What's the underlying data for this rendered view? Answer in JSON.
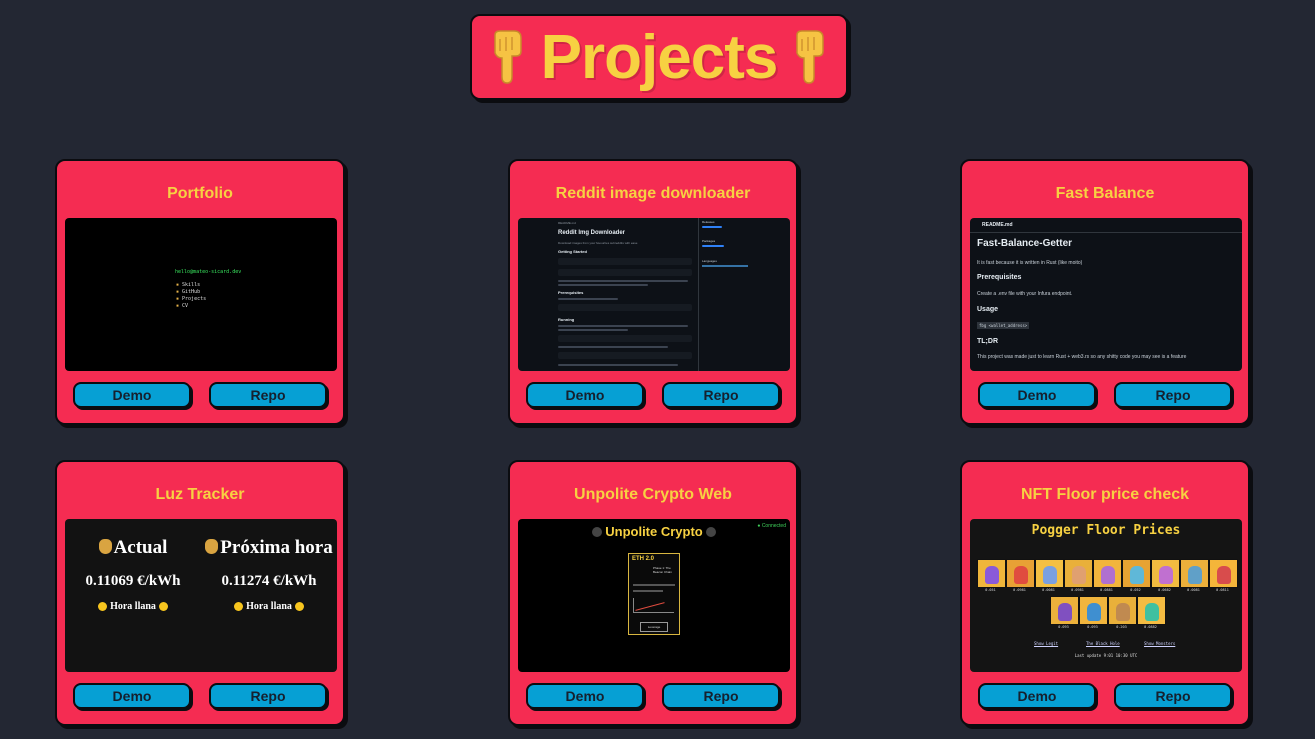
{
  "header": {
    "title": "Projects",
    "hand_icon": "backhand-index-pointing-down-icon"
  },
  "buttons": {
    "demo": "Demo",
    "repo": "Repo"
  },
  "colors": {
    "background": "#232733",
    "card": "#f52c52",
    "title": "#f7d142",
    "button": "#06a0d4"
  },
  "projects": [
    {
      "title": "Portfolio",
      "preview": {
        "prompt": "hello@mateo-sicard.dev",
        "menu": [
          "Skills",
          "GitHub",
          "Projects",
          "CV"
        ]
      }
    },
    {
      "title": "Reddit image downloader",
      "preview": {
        "file": "README.md",
        "heading": "Reddit Img Downloader",
        "subtitle": "Download images from your favourites subreddits with ease",
        "sections": [
          "Getting Started",
          "Prerequisites",
          "Running"
        ],
        "side_sections": [
          "Releases",
          "Packages",
          "Languages"
        ]
      }
    },
    {
      "title": "Fast Balance",
      "preview": {
        "file": "README.md",
        "heading": "Fast-Balance-Getter",
        "intro": "It is fast because it is written in Rust (like moito)",
        "prereq_heading": "Prerequisites",
        "prereq_text": "Create a .env file with your Infura endpoint.",
        "usage_heading": "Usage",
        "usage_code": "fbg <wallet_address>",
        "tldr_heading": "TL;DR",
        "tldr_text": "This project was made just to learn Rust + web3.rs so any shitty code you may see is a feature"
      }
    },
    {
      "title": "Luz Tracker",
      "preview": {
        "columns": [
          {
            "heading": "Actual",
            "value": "0.11069 €/kWh",
            "tag": "Hora llana"
          },
          {
            "heading": "Próxima hora",
            "value": "0.11274 €/kWh",
            "tag": "Hora llana"
          }
        ]
      }
    },
    {
      "title": "Unpolite Crypto Web",
      "preview": {
        "heading": "Unpolite Crypto",
        "status": "Connected",
        "card_title": "ETH 2.0",
        "card_subtitle": "Phase 1: The Beacon Chain",
        "button": "Leverage"
      }
    },
    {
      "title": "NFT Floor price check",
      "preview": {
        "heading": "Pogger Floor Prices",
        "row1_prices": [
          "0.051",
          "0.0981",
          "0.0081",
          "0.0981",
          "0.0881",
          "0.052",
          "0.0682",
          "0.0081",
          "0.0811"
        ],
        "row2_prices": [
          "0.093",
          "0.093",
          "0.203",
          "0.0882"
        ],
        "links": [
          "Show Legit",
          "The Black Hole",
          "Show Monsters"
        ],
        "footer": "Last update 9:01 10:30 UTC",
        "swatches": [
          "#f0b63b",
          "#e8a135",
          "#f4c043",
          "#e9b03a",
          "#f2b53c",
          "#e7a332",
          "#f1bb40",
          "#ecb03b",
          "#f4b53a",
          "#ecb13b",
          "#f1b53d",
          "#e9b03a",
          "#f4bc42"
        ],
        "creatures": [
          "#8a5ad8",
          "#e04c3f",
          "#7ba0e0",
          "#e0a070",
          "#b070d0",
          "#5fb8d8",
          "#c070d0",
          "#60a0c8",
          "#d84c4c",
          "#8050c0",
          "#3f8fd0",
          "#c08a50",
          "#40c0a0"
        ]
      }
    }
  ]
}
